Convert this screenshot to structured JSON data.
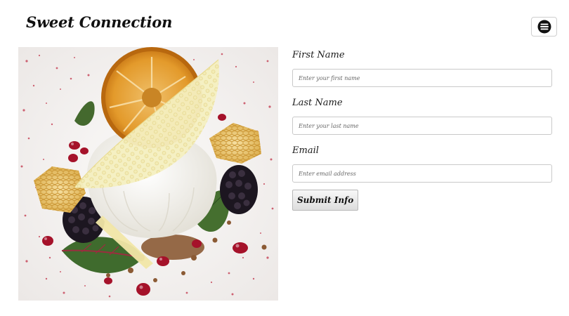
{
  "header": {
    "brand": "Sweet Connection",
    "menu_icon": "hamburger-menu-icon"
  },
  "hero": {
    "image_name": "dessert-photo"
  },
  "form": {
    "first_name": {
      "label": "First Name",
      "placeholder": "Enter your first name",
      "value": ""
    },
    "last_name": {
      "label": "Last Name",
      "placeholder": "Enter your last name",
      "value": ""
    },
    "email": {
      "label": "Email",
      "placeholder": "Enter email address",
      "value": ""
    },
    "submit_label": "Submit Info"
  },
  "colors": {
    "background": "#ffffff",
    "text": "#1a1a1a",
    "input_border": "#c9c9c9"
  }
}
